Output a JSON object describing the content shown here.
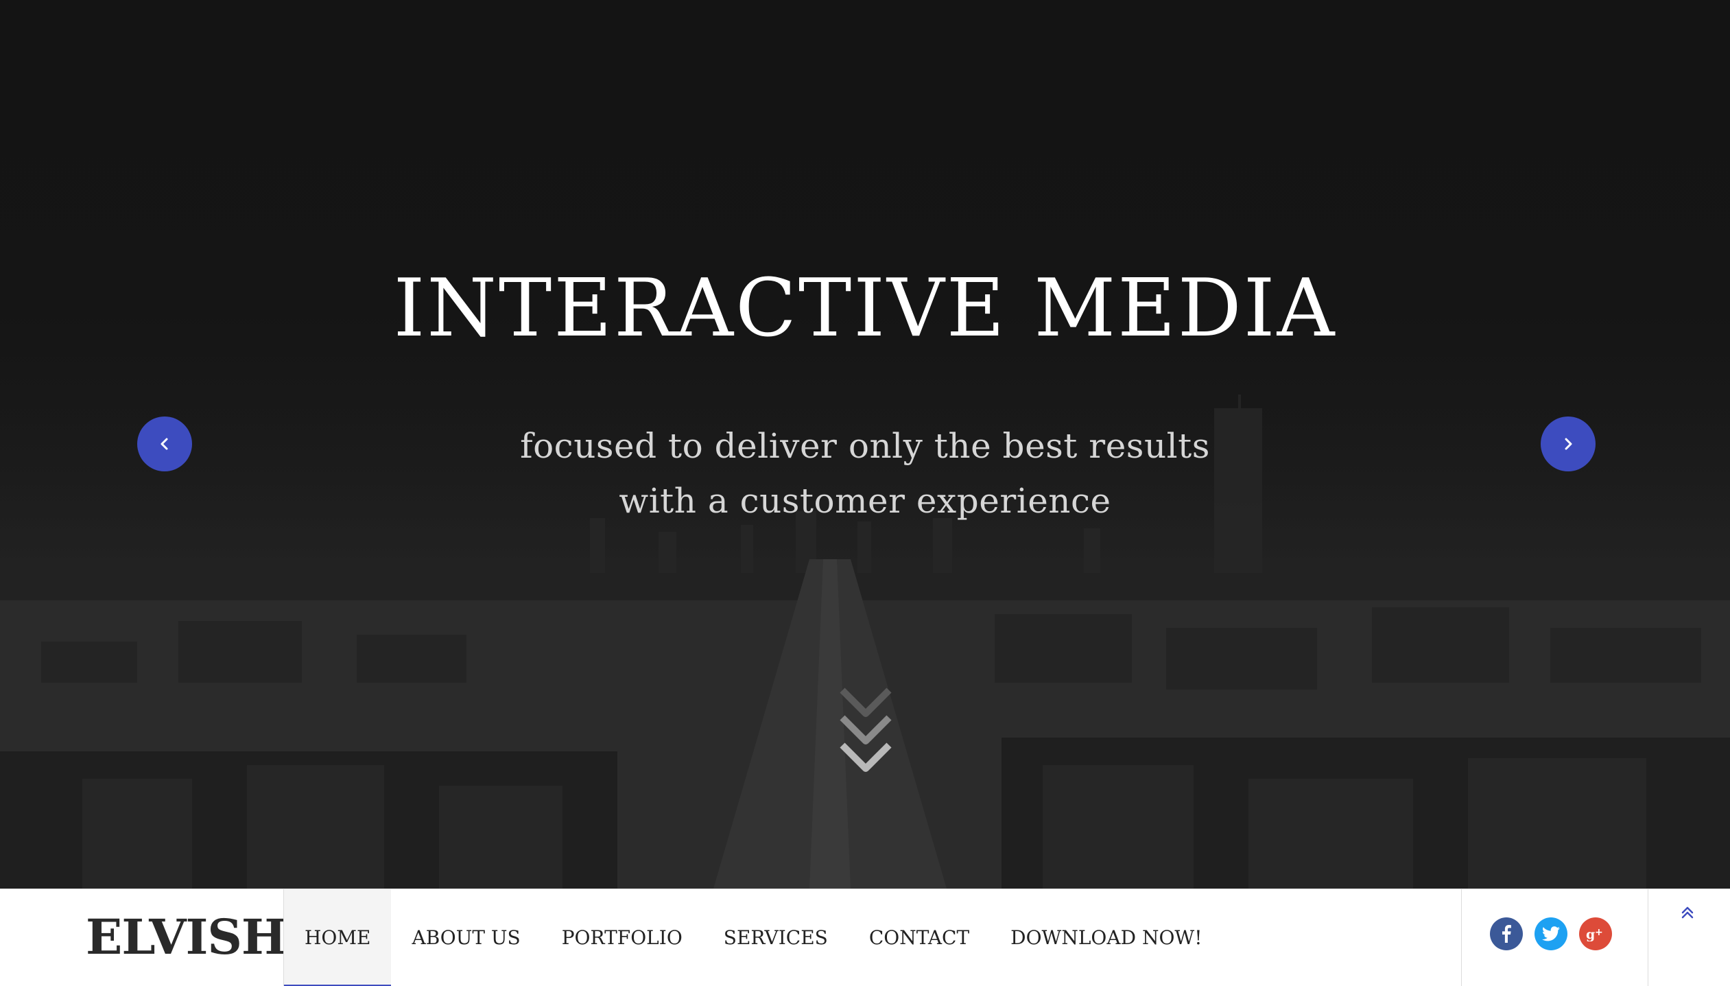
{
  "hero": {
    "title": "INTERACTIVE MEDIA",
    "subtitle_line1": "focused to deliver only the best results",
    "subtitle_line2": "with a customer experience",
    "prev_icon": "chevron-left-icon",
    "next_icon": "chevron-right-icon",
    "scroll_icon": "triple-chevron-down-icon"
  },
  "navbar": {
    "logo": "ELVISH",
    "menu": [
      {
        "label": "HOME",
        "active": true
      },
      {
        "label": "ABOUT US",
        "active": false
      },
      {
        "label": "PORTFOLIO",
        "active": false
      },
      {
        "label": "SERVICES",
        "active": false
      },
      {
        "label": "CONTACT",
        "active": false
      },
      {
        "label": "DOWNLOAD NOW!",
        "active": false
      }
    ],
    "social": [
      {
        "name": "facebook-icon",
        "glyph": "f",
        "color": "#3b5998"
      },
      {
        "name": "twitter-icon",
        "glyph": "t",
        "color": "#1da1f2"
      },
      {
        "name": "google-plus-icon",
        "glyph": "g+",
        "color": "#dd4b39"
      }
    ],
    "to_top_icon": "double-chevron-up-icon"
  },
  "colors": {
    "accent": "#3d4cbf",
    "hero_bg": "#141414",
    "navbar_bg": "#ffffff",
    "menu_active_bg": "#f4f4f4"
  }
}
